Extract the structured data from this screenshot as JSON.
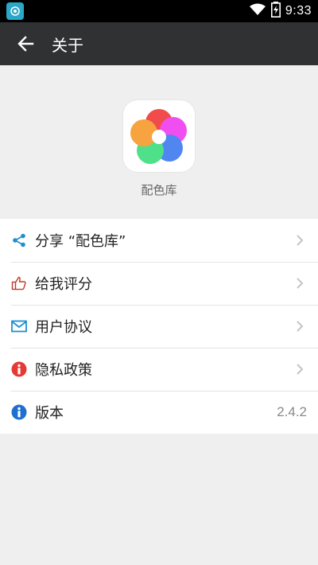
{
  "status_bar": {
    "time": "9:33",
    "icons": [
      "app-notification-icon",
      "wifi-icon",
      "battery-charging-icon"
    ]
  },
  "app_bar": {
    "back_icon": "arrow-left-icon",
    "title": "关于"
  },
  "app_info": {
    "logo_icon": "app-logo-icon",
    "name": "配色库"
  },
  "menu": {
    "items": [
      {
        "label": "分享 “配色库”",
        "icon": "share-icon",
        "icon_color": "#1e8fd0",
        "trailing": "chevron"
      },
      {
        "label": "给我评分",
        "icon": "thumbs-up-icon",
        "icon_color": "#c0392b",
        "trailing": "chevron"
      },
      {
        "label": "用户协议",
        "icon": "envelope-icon",
        "icon_color": "#1e8fd0",
        "trailing": "chevron"
      },
      {
        "label": "隐私政策",
        "icon": "info-circle-icon",
        "icon_color": "#e53935",
        "trailing": "chevron"
      },
      {
        "label": "版本",
        "icon": "info-circle-icon",
        "icon_color": "#1e6fd0",
        "value": "2.4.2"
      }
    ]
  },
  "colors": {
    "app_bar": "#2f3133",
    "background": "#efefef",
    "chevron": "#c4c4c4"
  }
}
